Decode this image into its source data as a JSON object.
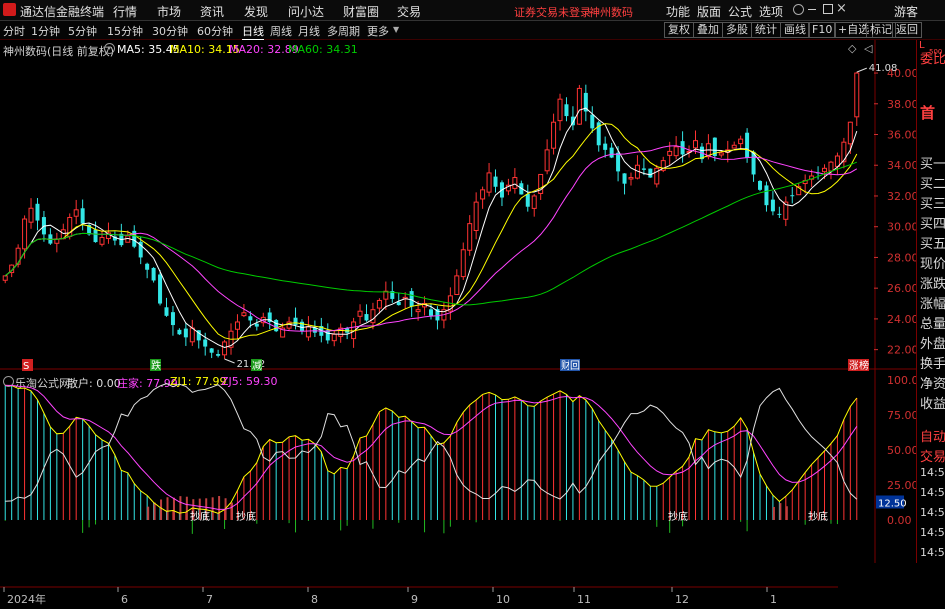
{
  "titlebar": {
    "app_title": "通达信金融终端",
    "menus": [
      "行情",
      "市场",
      "资讯",
      "发现",
      "问小达",
      "财富圈",
      "交易"
    ],
    "warning": "证券交易未登录",
    "stock_name": "神州数码",
    "right_buttons": [
      "功能",
      "版面",
      "公式",
      "选项"
    ],
    "guest": "游客"
  },
  "toolbar": {
    "periods": [
      "分时",
      "1分钟",
      "5分钟",
      "15分钟",
      "30分钟",
      "60分钟",
      "日线",
      "周线",
      "月线",
      "多周期",
      "更多"
    ],
    "active_period": "日线",
    "buttons": [
      "复权",
      "叠加",
      "多股",
      "统计",
      "画线",
      "F10",
      "+自选",
      "标记",
      "返回"
    ]
  },
  "main_legend": {
    "title": "神州数码(日线 前复权)",
    "ma5": "MA5: 35.45",
    "ma10": "MA10: 34.15",
    "ma20": "MA20: 32.89",
    "ma60": "MA60: 34.31"
  },
  "sub_legend": {
    "title": "乐淘公式网",
    "sanhu": "散户: 0.00",
    "zhuang": "庄家: 77.99",
    "zj1": "ZJ1: 77.99",
    "zj5": "ZJ5: 59.30"
  },
  "right_panel": {
    "badge_top": "L",
    "badge_bottom": "500",
    "items": [
      "委比",
      "首",
      "买一",
      "买二",
      "买三",
      "买四",
      "买五",
      "现价",
      "涨跌",
      "涨幅",
      "总量",
      "外盘",
      "换手",
      "净资",
      "收益",
      "自动",
      "交易",
      "14:56",
      "14:56",
      "14:56",
      "14:56",
      "14:56",
      "14:56",
      "14:56",
      "14:56",
      "14:56",
      "14:56"
    ]
  },
  "colors": {
    "up": "#ff3333",
    "down": "#33e6e6",
    "ma5": "#ffffff",
    "ma10": "#ffff00",
    "ma20": "#ff44ff",
    "ma60": "#00cc00",
    "grid": "#7a0000"
  },
  "chart_data": [
    {
      "type": "candlestick",
      "title": "神州数码(日线 前复权)",
      "ylim": [
        21,
        41.5
      ],
      "yticks": [
        "40.00",
        "38.00",
        "36.00",
        "34.00",
        "32.00",
        "30.00",
        "28.00",
        "26.00",
        "24.00",
        "22.00"
      ],
      "high_label": "41.08",
      "low_label": "21.22",
      "xticks": [
        "2024年",
        "6",
        "7",
        "8",
        "9",
        "10",
        "11",
        "12",
        "1",
        "2"
      ],
      "markers": [
        "S",
        "跌",
        "减",
        "财",
        "回",
        "涨",
        "榜"
      ],
      "close": [
        26.8,
        27.5,
        28.6,
        30.5,
        31.2,
        30.4,
        29.5,
        28.9,
        29.2,
        29.8,
        30.6,
        31.1,
        30.2,
        29.5,
        29.0,
        29.3,
        29.6,
        29.1,
        28.8,
        29.4,
        28.7,
        28.0,
        27.2,
        26.5,
        25.0,
        24.2,
        23.6,
        23.0,
        22.8,
        23.4,
        22.6,
        22.2,
        21.8,
        21.6,
        22.5,
        23.2,
        23.8,
        24.4,
        23.9,
        23.5,
        24.1,
        23.8,
        23.2,
        23.4,
        23.8,
        23.6,
        23.2,
        23.5,
        23.1,
        22.9,
        22.6,
        23.0,
        23.4,
        23.1,
        23.8,
        24.5,
        23.9,
        24.6,
        25.2,
        25.8,
        25.3,
        24.9,
        25.4,
        24.8,
        24.6,
        25.0,
        24.2,
        23.9,
        24.6,
        25.5,
        26.8,
        28.5,
        30.2,
        31.6,
        32.4,
        33.5,
        32.6,
        31.9,
        32.7,
        33.2,
        32.1,
        31.3,
        32.0,
        33.4,
        35.0,
        36.8,
        38.3,
        37.2,
        36.6,
        39.0,
        37.5,
        36.4,
        35.3,
        35.0,
        34.5,
        33.6,
        32.8,
        33.2,
        34.0,
        33.7,
        33.2,
        33.8,
        34.3,
        34.9,
        35.2,
        34.7,
        34.9,
        35.6,
        34.4,
        35.4,
        34.6,
        34.8,
        35.0,
        35.3,
        35.7,
        34.5,
        33.4,
        32.4,
        31.4,
        31.0,
        30.8,
        31.6,
        32.0,
        32.6,
        33.0,
        33.3,
        33.5,
        33.8,
        34.2,
        34.6,
        35.5,
        36.8,
        40.0
      ],
      "series": [
        {
          "name": "MA5"
        },
        {
          "name": "MA10"
        },
        {
          "name": "MA20"
        },
        {
          "name": "MA60"
        }
      ]
    },
    {
      "type": "line",
      "title": "乐淘公式网",
      "ylim": [
        0,
        100
      ],
      "yticks": [
        "100.0",
        "75.00",
        "50.00",
        "25.00",
        "0.00"
      ],
      "current_label": "12.50",
      "annotations": [
        "抄底",
        "抄底",
        "抄底",
        "抄底"
      ],
      "series": [
        {
          "name": "庄家"
        },
        {
          "name": "ZJ1"
        },
        {
          "name": "ZJ5"
        },
        {
          "name": "散户"
        }
      ]
    }
  ]
}
